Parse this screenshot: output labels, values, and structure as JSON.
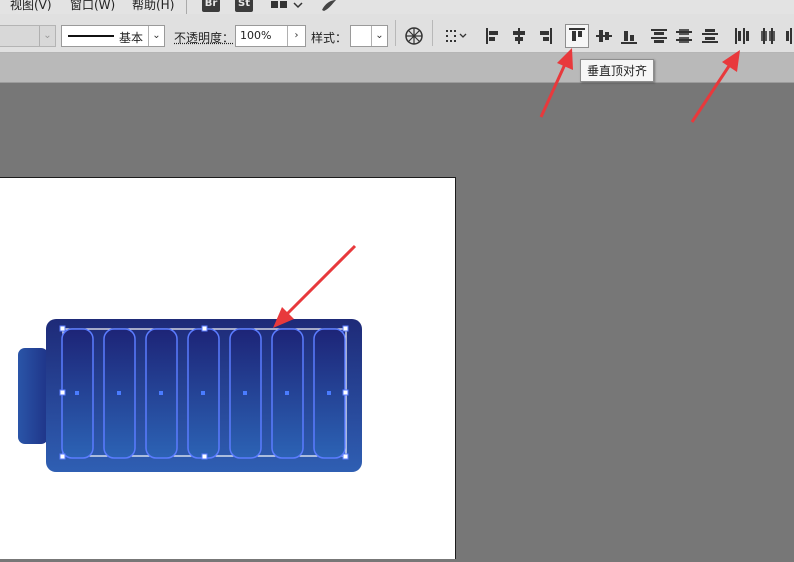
{
  "menubar": {
    "items": [
      "视图(V)",
      "窗口(W)",
      "帮助(H)"
    ],
    "apps": [
      "Br",
      "St"
    ]
  },
  "control_bar": {
    "stroke_profile_label": "基本",
    "opacity_label": "不透明度：",
    "opacity_value": "100%",
    "style_label": "样式：",
    "tooltip": "垂直顶对齐"
  },
  "colors": {
    "accent_arrow": "#e8393c",
    "battery_dark": "#1e2a78",
    "battery_light": "#2f5fb3",
    "selection": "#5b7cff"
  },
  "icons": [
    "dropdown-icon",
    "chevron-right-icon",
    "recolor-icon",
    "align-grid-icon",
    "align-left-icon",
    "align-center-horizontal-icon",
    "align-right-icon",
    "align-top-icon",
    "align-center-vertical-icon",
    "align-bottom-icon",
    "distribute-top-icon",
    "distribute-center-vertical-icon",
    "distribute-bottom-icon",
    "distribute-left-icon",
    "distribute-center-horizontal-icon",
    "distribute-right-icon"
  ]
}
